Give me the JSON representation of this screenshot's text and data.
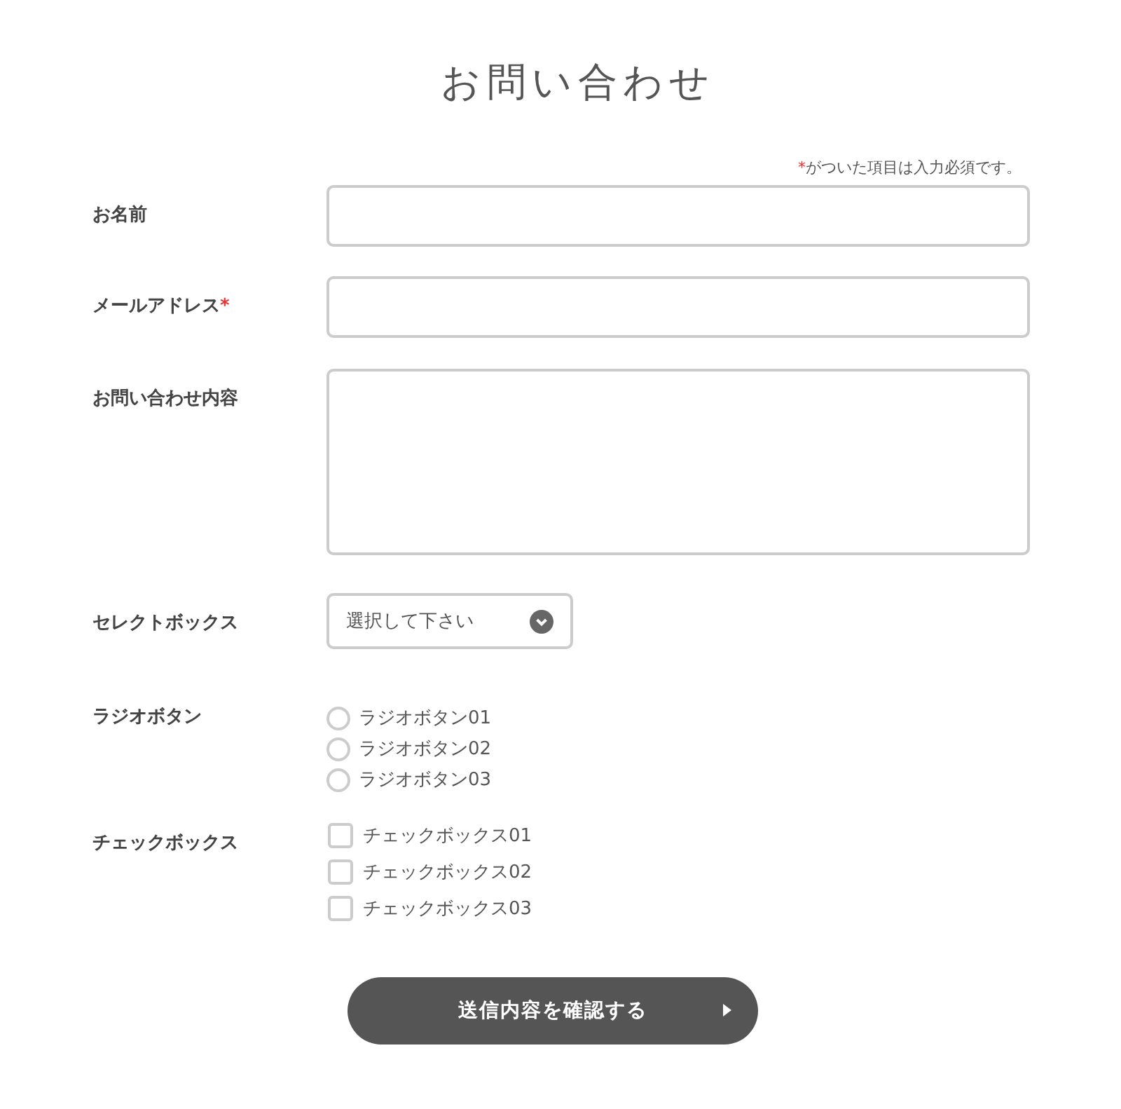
{
  "title": "お問い合わせ",
  "note": {
    "mark": "*",
    "text": "がついた項目は入力必須です。"
  },
  "fields": [
    {
      "kind": "text",
      "label": "お名前"
    },
    {
      "kind": "text",
      "label": "メールアドレス",
      "required_mark": "*"
    },
    {
      "kind": "textarea",
      "label": "お問い合わせ内容"
    },
    {
      "kind": "select",
      "label": "セレクトボックス",
      "value": "選択して下さい"
    },
    {
      "kind": "radio",
      "label": "ラジオボタン",
      "options": [
        {
          "label": "ラジオボタン01",
          "selected": false
        },
        {
          "label": "ラジオボタン02",
          "selected": false
        },
        {
          "label": "ラジオボタン03",
          "selected": false
        }
      ]
    },
    {
      "kind": "checkbox",
      "label": "チェックボックス",
      "options": [
        {
          "label": "チェックボックス01",
          "checked": false
        },
        {
          "label": "チェックボックス02",
          "checked": false
        },
        {
          "label": "チェックボックス03",
          "checked": false
        }
      ]
    }
  ],
  "submit": "送信内容を確認する"
}
